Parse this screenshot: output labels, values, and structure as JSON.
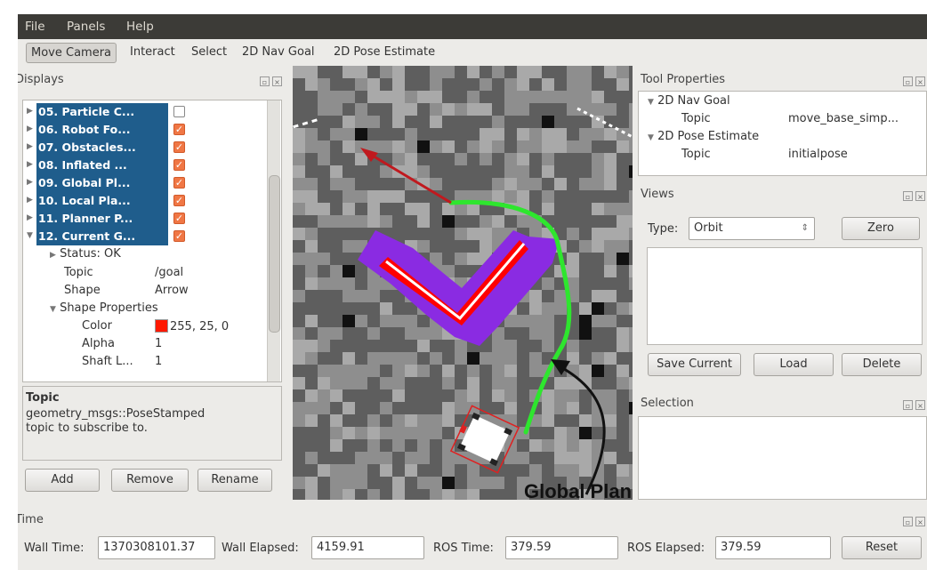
{
  "menu": [
    "File",
    "Panels",
    "Help"
  ],
  "toolbar": [
    "Move Camera",
    "Interact",
    "Select",
    "2D Nav Goal",
    "2D Pose Estimate"
  ],
  "displays": {
    "title": "Displays",
    "items": [
      {
        "label": "05. Particle C...",
        "checked": false
      },
      {
        "label": "06. Robot Fo...",
        "checked": true
      },
      {
        "label": "07. Obstacles...",
        "checked": true
      },
      {
        "label": "08. Inflated ...",
        "checked": true
      },
      {
        "label": "09. Global Pl...",
        "checked": true
      },
      {
        "label": "10. Local Pla...",
        "checked": true
      },
      {
        "label": "11. Planner P...",
        "checked": true
      },
      {
        "label": "12. Current G...",
        "checked": true
      }
    ],
    "status": "Status: OK",
    "topic_key": "Topic",
    "topic_val": "/goal",
    "shape_key": "Shape",
    "shape_val": "Arrow",
    "shape_props": "Shape Properties",
    "color_key": "Color",
    "color_val": "255, 25, 0",
    "color_hex": "#ff1900",
    "alpha_key": "Alpha",
    "alpha_val": "1",
    "shaft_key": "Shaft L...",
    "shaft_val": "1",
    "desc_title": "Topic",
    "desc_text": "geometry_msgs::PoseStamped topic to subscribe to.",
    "buttons": [
      "Add",
      "Remove",
      "Rename"
    ]
  },
  "viewport": {
    "annotation": "Global Plan"
  },
  "tool_properties": {
    "title": "Tool Properties",
    "nav_goal": "2D Nav Goal",
    "nav_topic_key": "Topic",
    "nav_topic_val": "move_base_simp...",
    "pose_est": "2D Pose Estimate",
    "pose_topic_key": "Topic",
    "pose_topic_val": "initialpose"
  },
  "views": {
    "title": "Views",
    "type_label": "Type:",
    "type_value": "Orbit",
    "zero": "Zero",
    "save": "Save Current",
    "load": "Load",
    "delete": "Delete"
  },
  "selection": {
    "title": "Selection"
  },
  "time": {
    "title": "Time",
    "wall_time_label": "Wall Time:",
    "wall_time": "1370308101.37",
    "wall_elapsed_label": "Wall Elapsed:",
    "wall_elapsed": "4159.91",
    "ros_time_label": "ROS Time:",
    "ros_time": "379.59",
    "ros_elapsed_label": "ROS Elapsed:",
    "ros_elapsed": "379.59",
    "reset": "Reset"
  },
  "colors": {
    "selection": "#1f5d8c",
    "checkbox": "#f07745",
    "plan": "#2ee62e",
    "inflated": "#8a2be2",
    "obstacle": "#ff0000"
  }
}
